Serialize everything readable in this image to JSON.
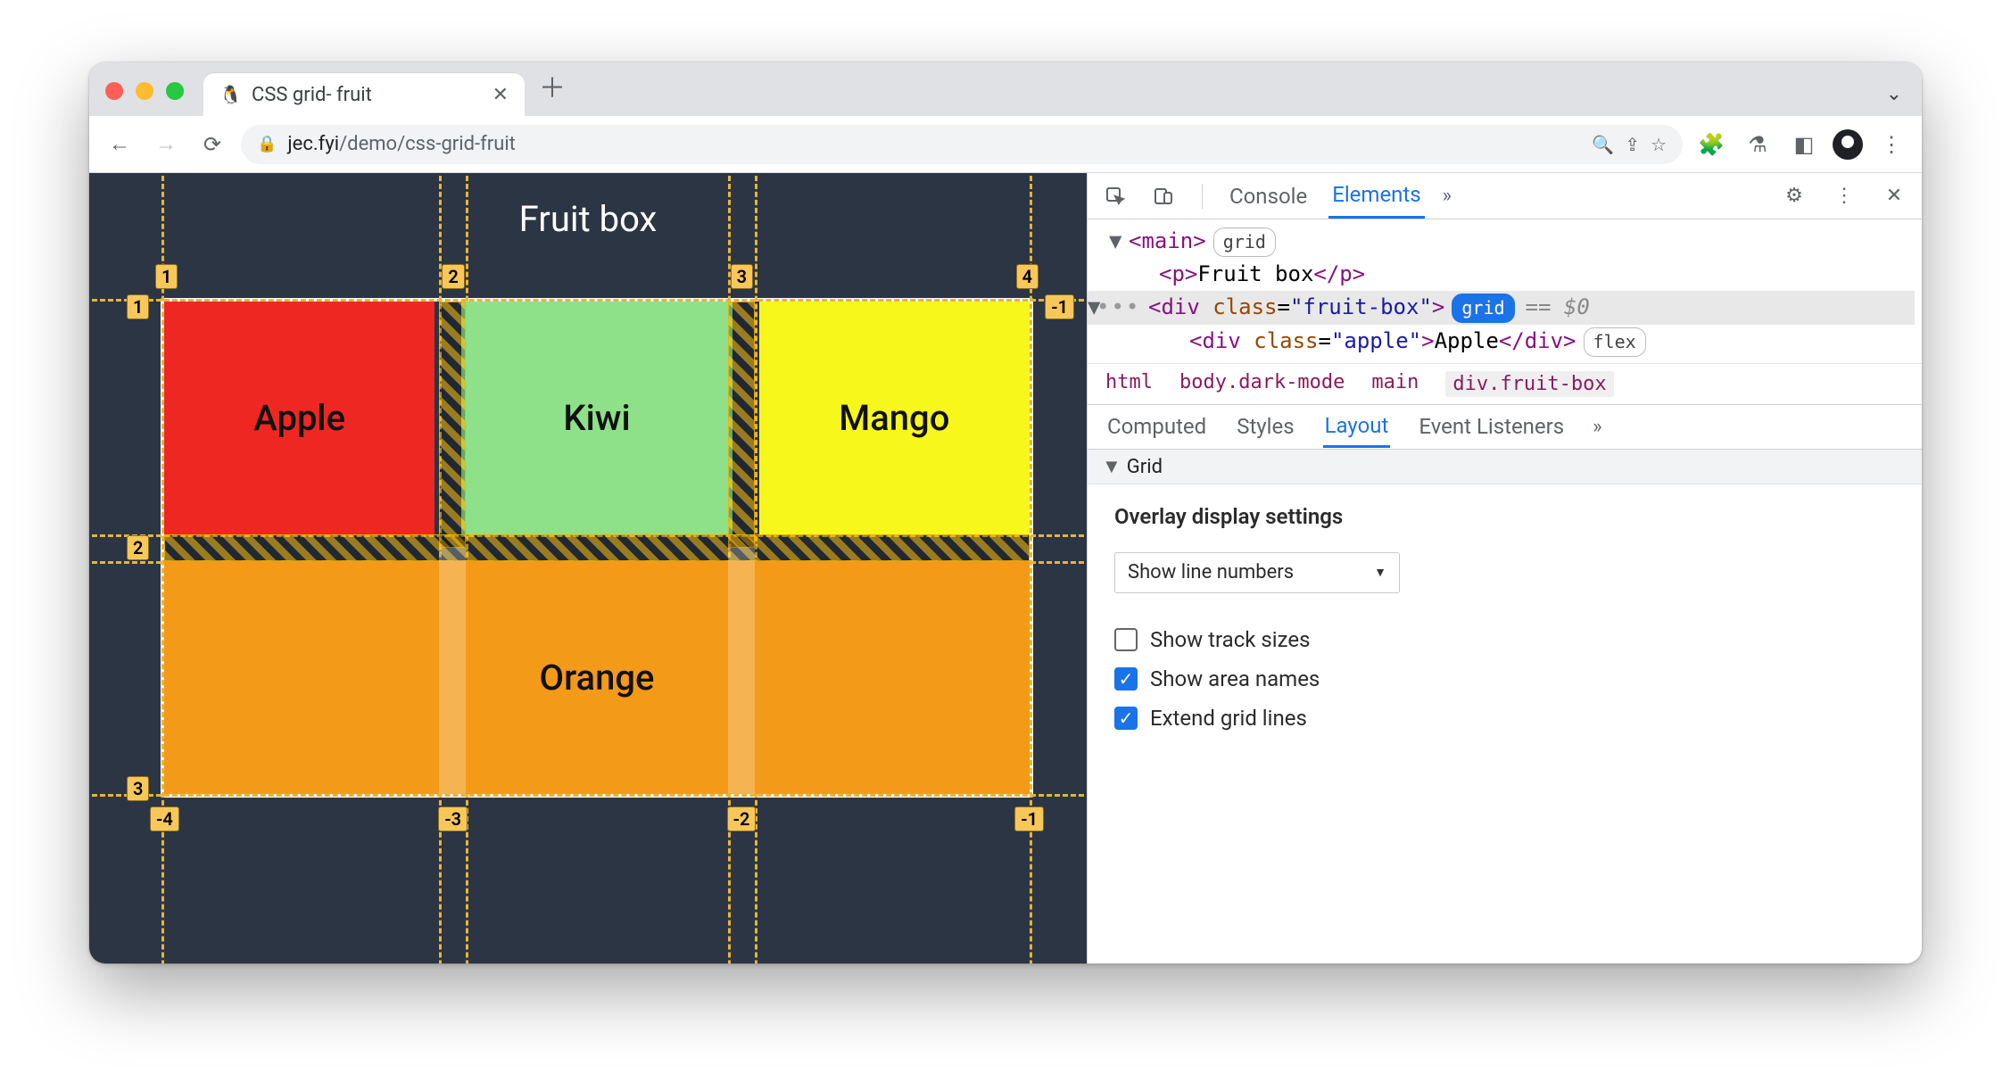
{
  "tab": {
    "title": "CSS grid- fruit"
  },
  "url": {
    "host": "jec.fyi",
    "path": "/demo/css-grid-fruit"
  },
  "page": {
    "title": "Fruit box",
    "cells": {
      "apple": "Apple",
      "kiwi": "Kiwi",
      "mango": "Mango",
      "orange": "Orange"
    },
    "line_numbers": {
      "col_top": [
        "1",
        "2",
        "3",
        "4"
      ],
      "row_left": [
        "1",
        "2",
        "3"
      ],
      "row_right": [
        "-1"
      ],
      "col_bottom": [
        "-4",
        "-3",
        "-2",
        "-1"
      ]
    }
  },
  "devtools": {
    "top_tabs": {
      "console": "Console",
      "elements": "Elements"
    },
    "dom": {
      "main_open": "<main>",
      "grid_pill": "grid",
      "p_open": "<p>",
      "p_text": "Fruit box",
      "p_close": "</p>",
      "div_open_prefix": "<div ",
      "class_attr": "class",
      "fruit_box_val": "\"fruit-box\"",
      "div_open_suffix": ">",
      "grid_pill2": "grid",
      "eq0": "== $0",
      "apple_open_prefix": "<div ",
      "apple_val": "\"apple\"",
      "apple_text": "Apple",
      "apple_close": "</div>",
      "flex_pill": "flex"
    },
    "breadcrumbs": [
      "html",
      "body.dark-mode",
      "main",
      "div.fruit-box"
    ],
    "sub_tabs": {
      "computed": "Computed",
      "styles": "Styles",
      "layout": "Layout",
      "events": "Event Listeners"
    },
    "grid_section": "Grid",
    "overlay_title": "Overlay display settings",
    "select_value": "Show line numbers",
    "checks": {
      "track_sizes": {
        "label": "Show track sizes",
        "checked": false
      },
      "area_names": {
        "label": "Show area names",
        "checked": true
      },
      "extend_lines": {
        "label": "Extend grid lines",
        "checked": true
      }
    }
  }
}
